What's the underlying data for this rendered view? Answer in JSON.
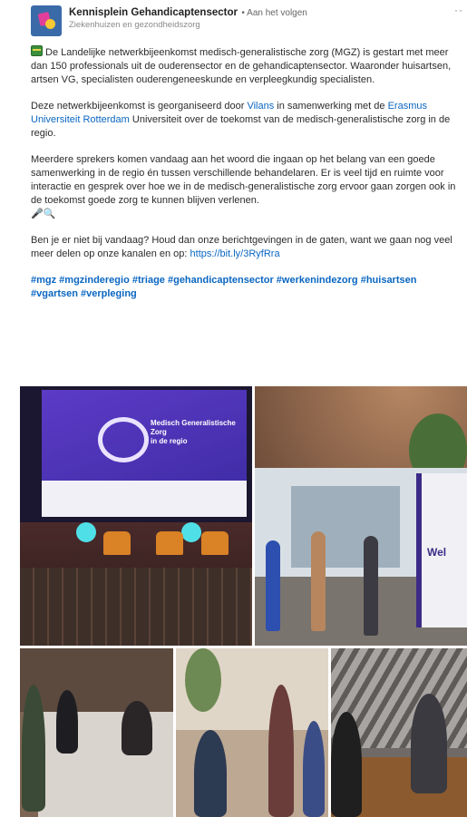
{
  "header": {
    "org_name": "Kennisplein Gehandicaptensector",
    "follow_label": "• Aan het volgen",
    "subtitle": "Ziekenhuizen en gezondheidszorg",
    "more_icon": "··"
  },
  "post": {
    "p1": "De Landelijke netwerkbijeenkomst medisch-generalistische zorg (MGZ) is gestart met meer dan 150 professionals uit de ouderensector en de gehandicaptensector. Waaronder huisartsen, artsen VG, specialisten ouderengeneeskunde en verpleegkundig specialisten.",
    "p2_a": "Deze netwerkbijeenkomst is georganiseerd door ",
    "p2_link1": "Vilans",
    "p2_b": " in samenwerking met de ",
    "p2_link2": "Erasmus Universiteit Rotterdam",
    "p2_c": " Universiteit over de toekomst van de medisch-generalistische zorg in de regio.",
    "p3": "Meerdere sprekers komen vandaag aan het woord die ingaan op het belang van een goede samenwerking in de regio én tussen verschillende behandelaren. Er is veel tijd en ruimte voor interactie en gesprek over hoe we in de medisch-generalistische zorg ervoor gaan zorgen ook in de toekomst goede zorg te kunnen blijven verlenen.",
    "p3_emoji": "🎤🔍",
    "p4_a": "Ben je er niet bij vandaag? Houd dan onze berichtgevingen in de gaten, want we gaan nog veel meer delen op onze kanalen en op: ",
    "p4_link": "https://bit.ly/3RyfRra",
    "hashtags": "#mgz #mgzinderegio #triage #gehandicaptensector #werkenindezorg #huisartsen #vgartsen #verpleging"
  },
  "photos": {
    "slide_title": "Medisch Generalistische Zorg",
    "slide_sub": "in de regio",
    "banner_text": "Wel"
  }
}
